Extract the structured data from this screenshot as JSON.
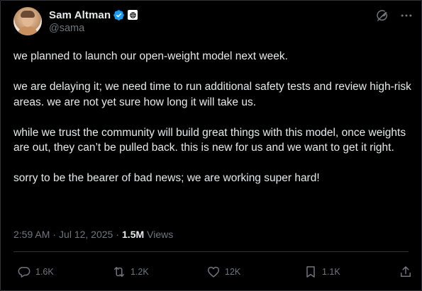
{
  "author": {
    "display_name": "Sam Altman",
    "handle": "@sama",
    "verified": true
  },
  "post": {
    "paragraphs": [
      "we planned to launch our open-weight model next week.",
      "we are delaying it; we need time to run additional safety tests and review high-risk areas. we are not yet sure how long it will take us.",
      "while we trust the community will build great things with this model, once weights are out, they can’t be pulled back. this is new for us and we want to get it right.",
      "sorry to be the bearer of bad news; we are working super hard!"
    ],
    "time": "2:59 AM",
    "date": "Jul 12, 2025",
    "separator": "·",
    "views_count": "1.5M",
    "views_label": "Views"
  },
  "actions": {
    "replies": "1.6K",
    "reposts": "1.2K",
    "likes": "12K",
    "bookmarks": "1.1K"
  },
  "icons": {
    "verified": "verified-badge-icon",
    "affiliation": "openai-logo-icon",
    "grok": "grok-icon",
    "more": "more-icon",
    "reply": "reply-icon",
    "repost": "repost-icon",
    "like": "heart-icon",
    "bookmark": "bookmark-icon",
    "share": "share-icon"
  },
  "colors": {
    "background": "#000000",
    "text": "#e7e9ea",
    "muted": "#71767b",
    "border": "#2f3336",
    "verified": "#1d9bf0"
  }
}
